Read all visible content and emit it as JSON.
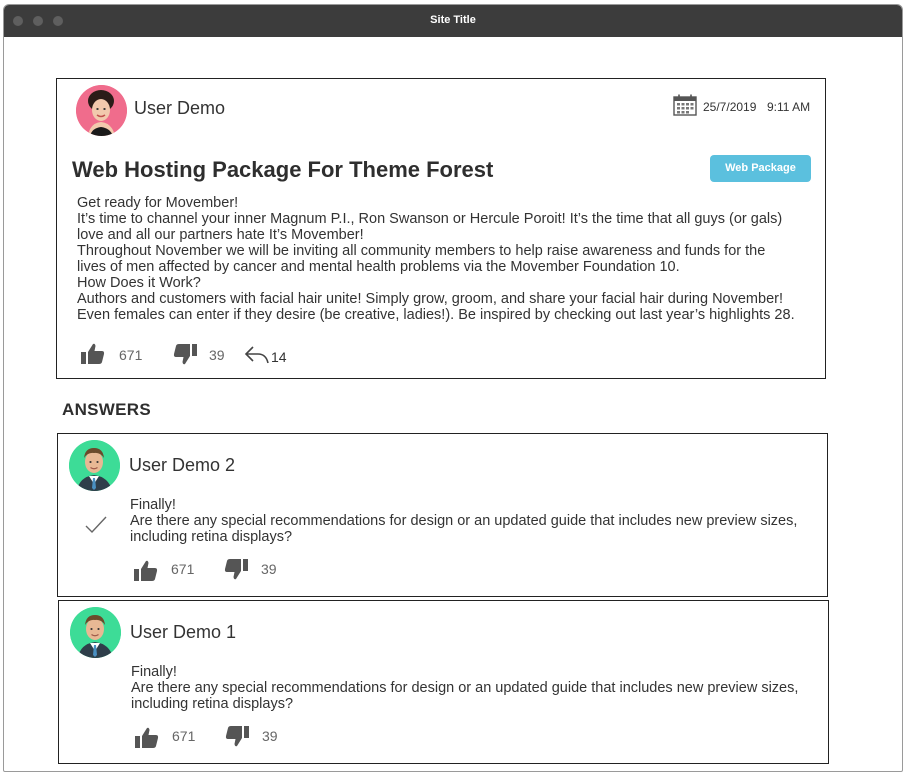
{
  "window": {
    "title": "Site Title"
  },
  "question": {
    "author": "User Demo",
    "date": "25/7/2019",
    "time": "9:11 AM",
    "title": "Web Hosting Package For Theme Forest",
    "tag": "Web Package",
    "body": [
      "Get ready for Movember!",
      "It’s time to channel your inner Magnum P.I., Ron Swanson or Hercule Poroit! It’s the time that all guys (or gals)",
      "love and all our partners hate It’s Movember!",
      "Throughout November we will be inviting all community members to help raise awareness and funds for the",
      "lives of men affected by cancer and mental health problems via the Movember Foundation 10.",
      "How Does it Work?",
      "Authors and customers with facial hair unite! Simply grow, groom, and share your facial hair during November!",
      "Even females can enter if they desire (be creative, ladies!). Be inspired by checking out last year’s highlights 28."
    ],
    "likes": "671",
    "dislikes": "39",
    "replies": "14",
    "avatar_color": "#f06c8c"
  },
  "answers_heading": "ANSWERS",
  "answers": [
    {
      "author": "User Demo 2",
      "accepted": true,
      "body": [
        "Finally!",
        "Are there any special recommendations for design or an updated guide that includes new preview sizes,",
        "including retina displays?"
      ],
      "likes": "671",
      "dislikes": "39",
      "avatar_color": "#3ddc97"
    },
    {
      "author": "User Demo 1",
      "accepted": false,
      "body": [
        "Finally!",
        "Are there any special recommendations for design or an updated guide that includes new preview sizes,",
        "including retina displays?"
      ],
      "likes": "671",
      "dislikes": "39",
      "avatar_color": "#3ddc97"
    }
  ]
}
